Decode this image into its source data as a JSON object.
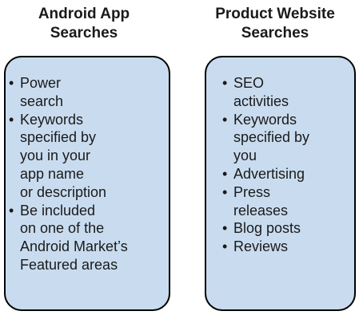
{
  "left": {
    "title_lines": [
      "Android App",
      "Searches"
    ],
    "items": [
      "Power\nsearch",
      "Keywords\nspecified by\nyou in your\napp name\nor description",
      "Be included\non one of the\nAndroid Market’s\nFeatured areas"
    ]
  },
  "right": {
    "title_lines": [
      "Product Website",
      "Searches"
    ],
    "items": [
      "SEO\nactivities",
      "Keywords\nspecified by\nyou",
      "Advertising",
      "Press\nreleases",
      "Blog posts",
      "Reviews"
    ]
  },
  "bullet_glyph": "•",
  "colors": {
    "panel_fill": "#c9dcef",
    "panel_border": "#000000"
  }
}
